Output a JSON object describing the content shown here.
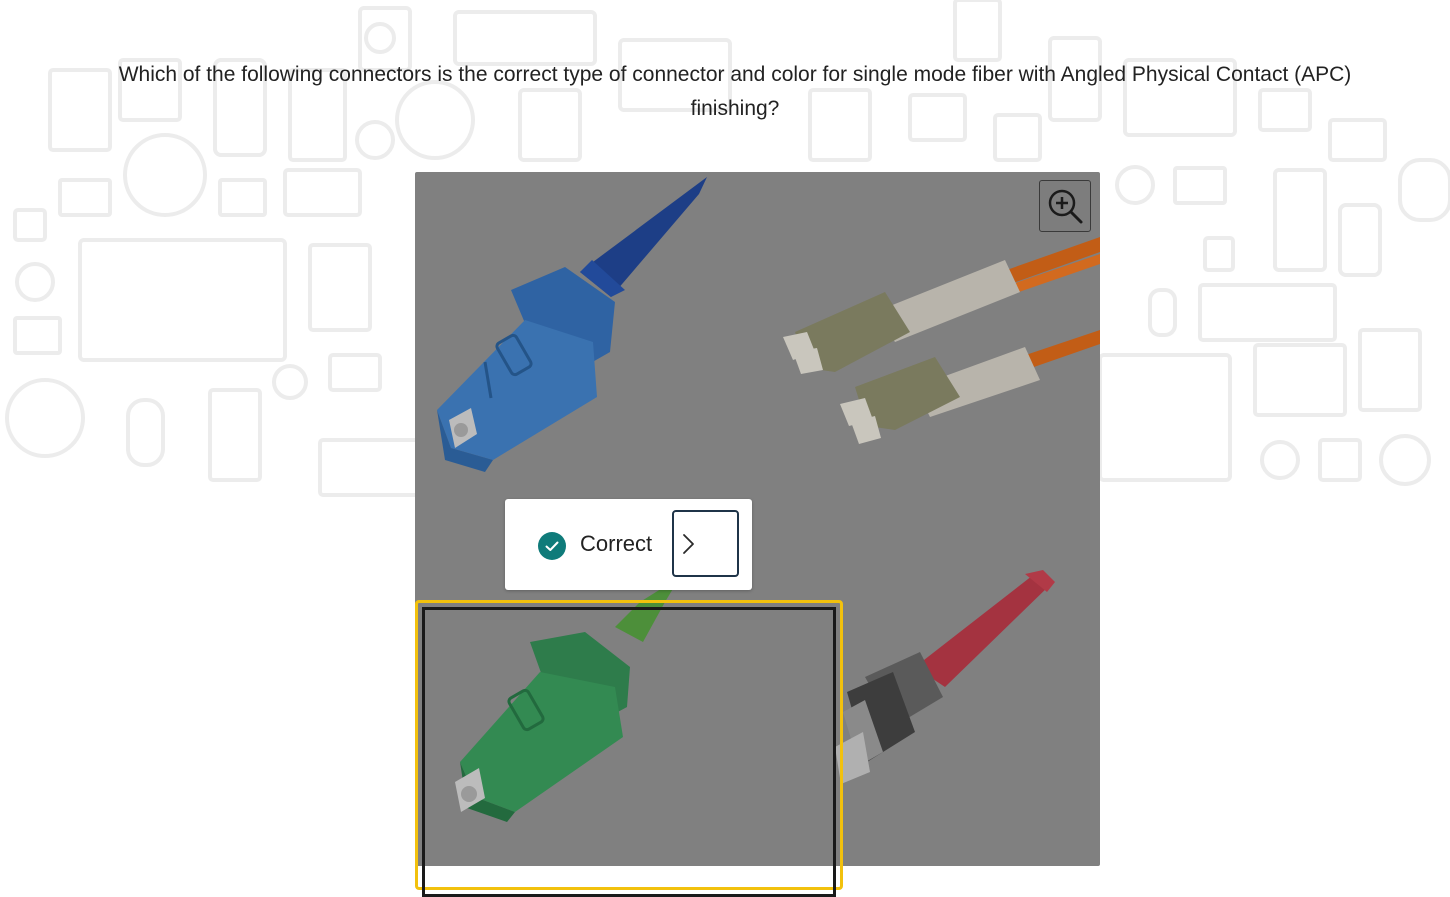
{
  "question": {
    "line1": "Which of the following connectors is the correct type of connector and color for single mode fiber with Angled Physical Contact (APC)",
    "line2": "finishing?"
  },
  "image": {
    "connectors": [
      "blue-sc-connector",
      "orange-lc-duplex-connector",
      "green-sc-apc-connector",
      "red-st-connector"
    ]
  },
  "zoom": {
    "icon": "zoom-in-icon"
  },
  "feedback": {
    "status": "Correct",
    "status_icon": "check-circle-icon",
    "next_icon": "chevron-right-icon",
    "status_color": "#0f7b7a"
  },
  "colors": {
    "selection_outline": "#f2c10d",
    "overlay": "#808080"
  }
}
